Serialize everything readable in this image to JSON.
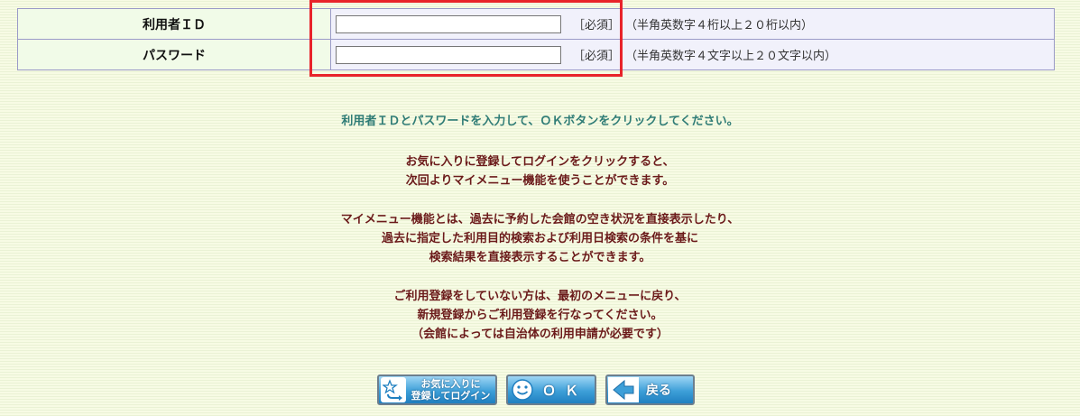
{
  "form": {
    "rows": [
      {
        "label": "利用者ＩＤ",
        "value": "",
        "required": "［必須］",
        "hint": "（半角英数字４桁以上２０桁以内）"
      },
      {
        "label": "パスワード",
        "value": "",
        "required": "［必須］",
        "hint": "（半角英数字４文字以上２０文字以内）"
      }
    ]
  },
  "instructions": {
    "main": "利用者ＩＤとパスワードを入力して、ＯＫボタンをクリックしてください。",
    "para1": [
      "お気に入りに登録してログインをクリックすると、",
      "次回よりマイメニュー機能を使うことができます。"
    ],
    "para2": [
      "マイメニュー機能とは、過去に予約した会館の空き状況を直接表示したり、",
      "過去に指定した利用目的検索および利用日検索の条件を基に",
      "検索結果を直接表示することができます。"
    ],
    "para3": [
      "ご利用登録をしていない方は、最初のメニューに戻り、",
      "新規登録からご利用登録を行なってください。",
      "（会館によっては自治体の利用申請が必要です）"
    ]
  },
  "buttons": {
    "favorite_login": {
      "line1": "お気に入りに",
      "line2": "登録してログイン",
      "icon": "star-arrow-icon"
    },
    "ok": {
      "label": "ＯＫ",
      "icon": "smiley-icon"
    },
    "back": {
      "label": "戻る",
      "icon": "back-arrow-icon"
    }
  },
  "colors": {
    "teal_text": "#2f7c76",
    "maroon_text": "#6b1a1a",
    "highlight": "#e8232a",
    "button_blue": "#3d9fd8"
  }
}
